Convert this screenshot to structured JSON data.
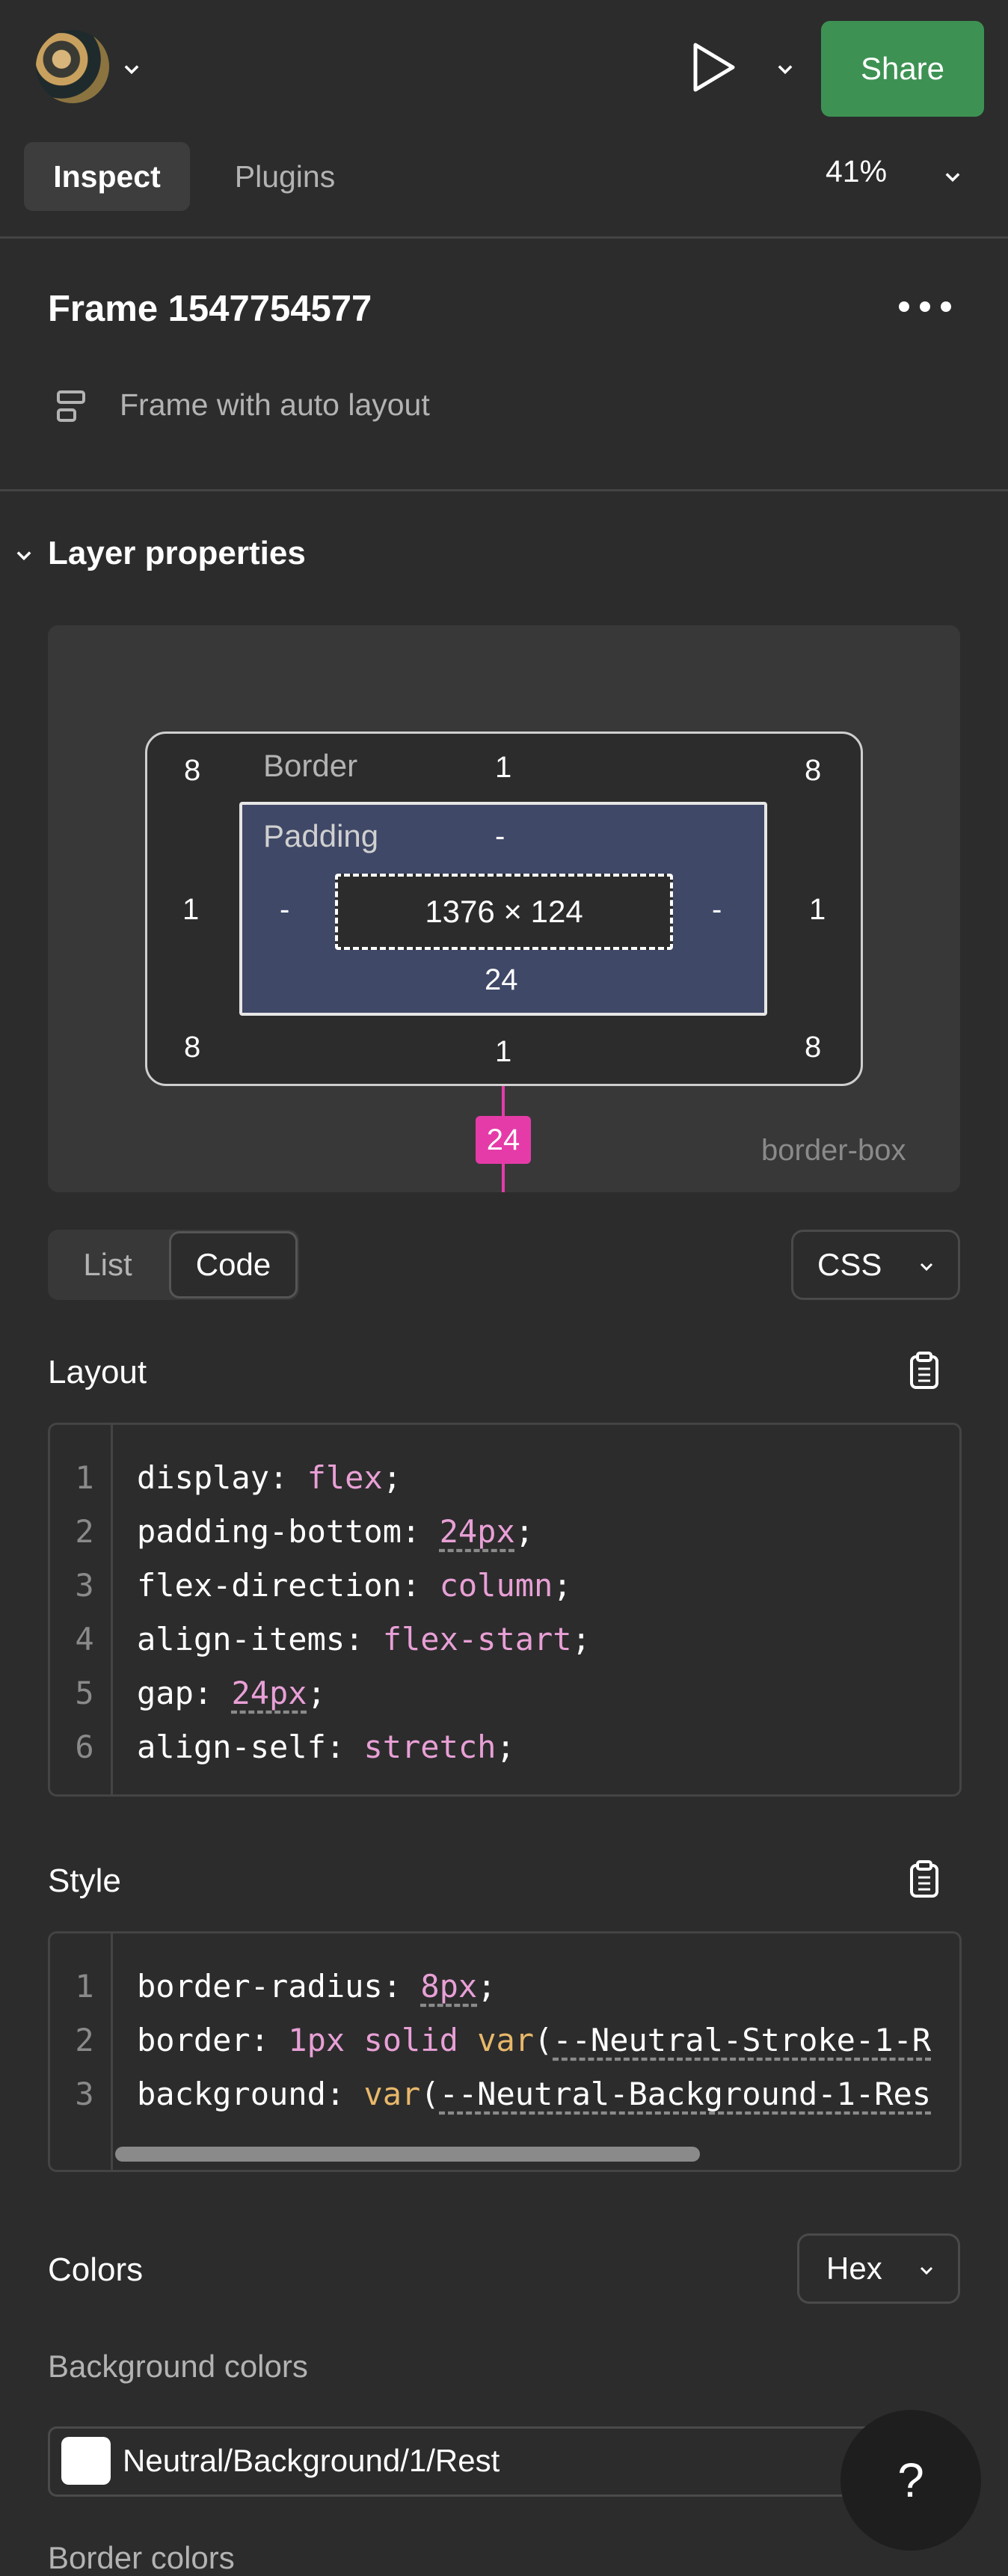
{
  "toolbar": {
    "share_label": "Share",
    "tabs": [
      {
        "label": "Inspect",
        "active": true
      },
      {
        "label": "Plugins",
        "active": false
      }
    ],
    "zoom": "41%"
  },
  "frame": {
    "title": "Frame 1547754577",
    "subtitle": "Frame with auto layout"
  },
  "layer_properties": {
    "title": "Layer properties",
    "box_model": {
      "border_label": "Border",
      "padding_label": "Padding",
      "radius_top_left": "8",
      "radius_top_right": "8",
      "radius_bottom_left": "8",
      "radius_bottom_right": "8",
      "border_top": "1",
      "border_left": "1",
      "border_right": "1",
      "border_bottom": "1",
      "padding_top": "-",
      "padding_left": "-",
      "padding_right": "-",
      "padding_bottom": "24",
      "content_size": "1376 × 124",
      "gap": "24",
      "box_sizing": "border-box"
    }
  },
  "view_toggle": {
    "list_label": "List",
    "code_label": "Code",
    "language": "CSS"
  },
  "layout": {
    "title": "Layout",
    "lines": [
      {
        "n": "1",
        "prop": "display",
        "value": "flex"
      },
      {
        "n": "2",
        "prop": "padding-bottom",
        "value": "24px"
      },
      {
        "n": "3",
        "prop": "flex-direction",
        "value": "column"
      },
      {
        "n": "4",
        "prop": "align-items",
        "value": "flex-start"
      },
      {
        "n": "5",
        "prop": "gap",
        "value": "24px"
      },
      {
        "n": "6",
        "prop": "align-self",
        "value": "stretch"
      }
    ]
  },
  "style": {
    "title": "Style",
    "lines": [
      {
        "n": "1",
        "prop": "border-radius",
        "value": "8px"
      },
      {
        "n": "2",
        "prop": "border",
        "value_parts": [
          "1px",
          "solid",
          "var",
          "--Neutral-Stroke-1-R"
        ]
      },
      {
        "n": "3",
        "prop": "background",
        "value_parts": [
          "var",
          "--Neutral-Background-1-Res"
        ]
      }
    ]
  },
  "colors": {
    "title": "Colors",
    "format": "Hex",
    "background_label": "Background colors",
    "background_items": [
      {
        "name": "Neutral/Background/1/Rest",
        "swatch": "#ffffff"
      }
    ],
    "border_label": "Border colors"
  },
  "help_label": "?",
  "theme": {
    "share_green": "#3d9253",
    "magenta": "#e53ba8",
    "padding_fill": "#3f4866",
    "code_value_pink": "#e8a0d6",
    "code_fn_orange": "#e8b86a"
  }
}
